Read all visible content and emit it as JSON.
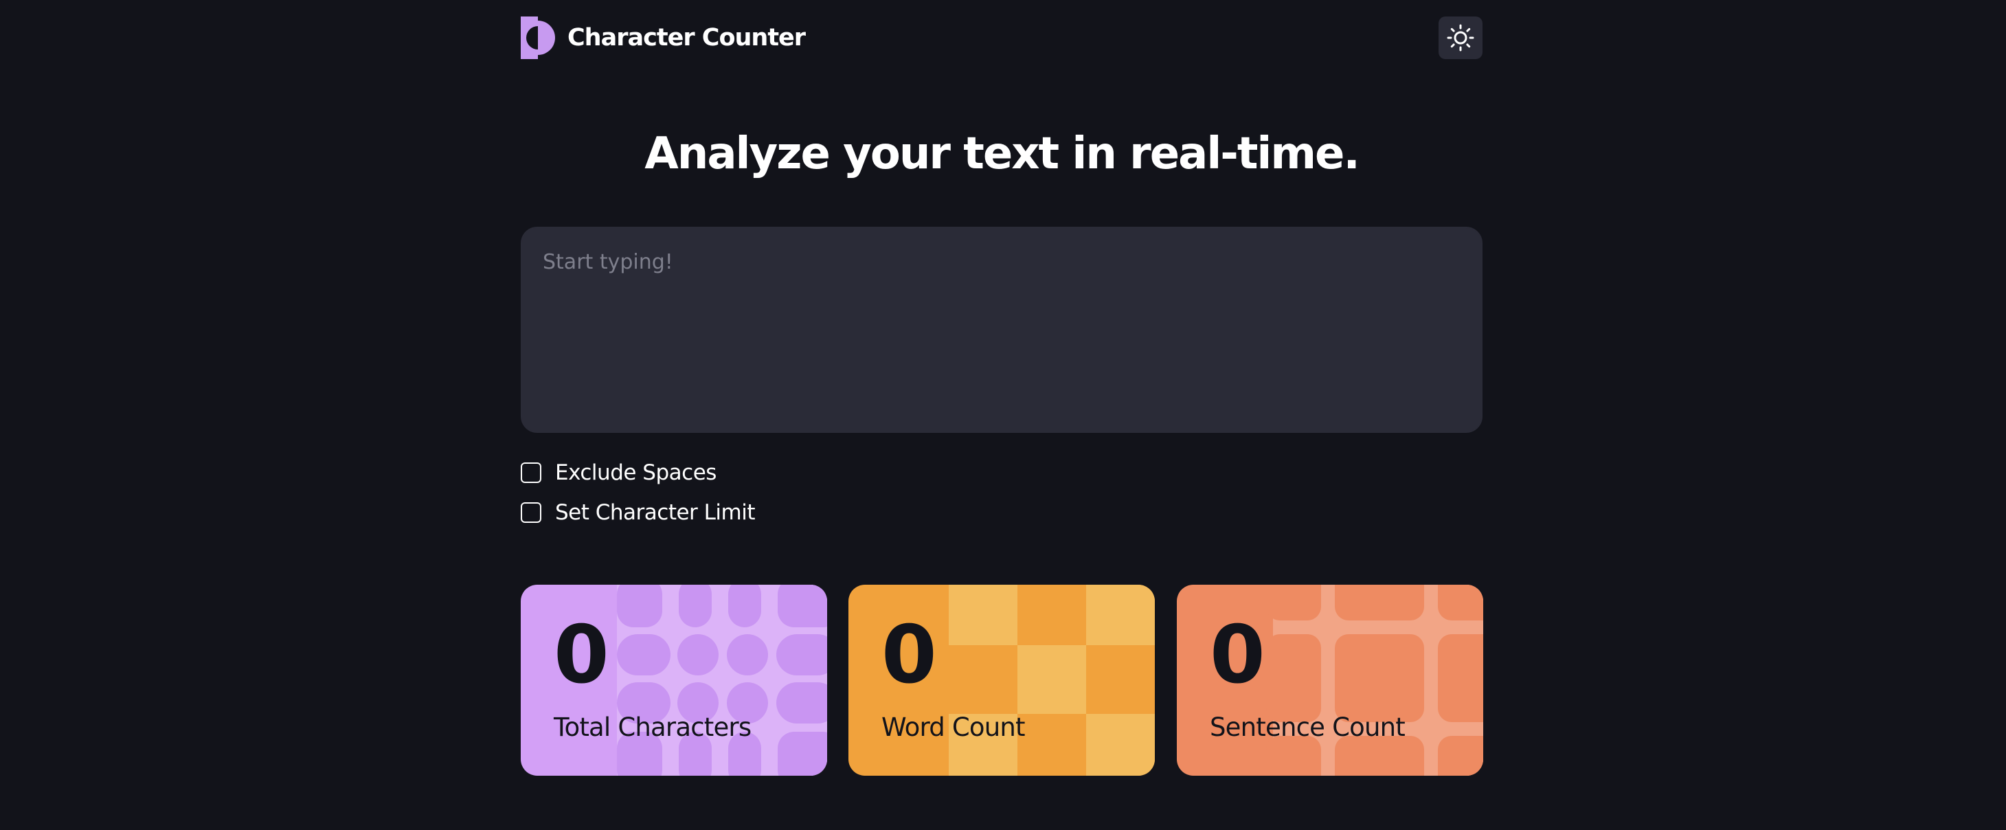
{
  "header": {
    "app_name": "Character Counter",
    "logo_icon": "half-moon-logo-icon",
    "theme_toggle_icon": "sun-icon"
  },
  "headline": "Analyze your text in real-time.",
  "editor": {
    "placeholder": "Start typing!",
    "value": ""
  },
  "options": [
    {
      "label": "Exclude Spaces",
      "checked": false
    },
    {
      "label": "Set Character Limit",
      "checked": false
    }
  ],
  "stats": [
    {
      "value": "0",
      "label": "Total Characters",
      "color": "#d3a0f6"
    },
    {
      "value": "0",
      "label": "Word Count",
      "color": "#f1a23c"
    },
    {
      "value": "0",
      "label": "Sentence Count",
      "color": "#ee8b62"
    }
  ],
  "colors": {
    "background": "#12131a",
    "surface": "#2a2b37",
    "accent_purple": "#d3a0f6",
    "accent_orange": "#f1a23c",
    "accent_coral": "#ee8b62"
  }
}
